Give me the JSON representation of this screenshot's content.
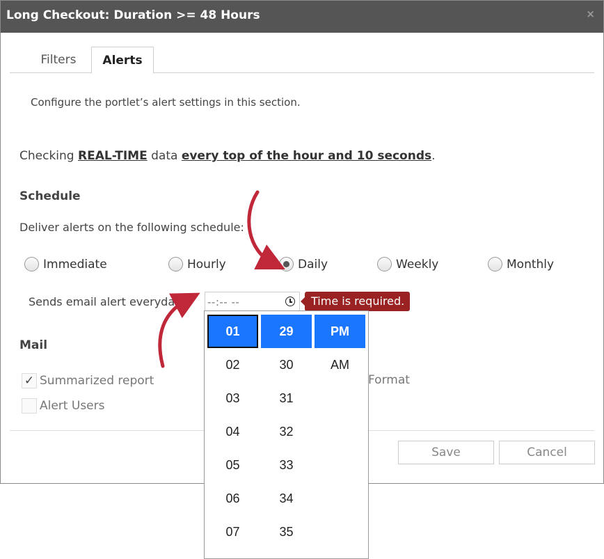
{
  "dialog": {
    "title": "Long Checkout: Duration >= 48 Hours",
    "close_glyph": "×"
  },
  "tabs": [
    {
      "label": "Filters"
    },
    {
      "label": "Alerts"
    }
  ],
  "alerts": {
    "description": "Configure the portlet’s alert settings in this section.",
    "checking_prefix": "Checking ",
    "checking_source": "REAL-TIME",
    "checking_mid": " data ",
    "checking_frequency": "every top of the hour and 10 seconds",
    "checking_suffix": ".",
    "schedule_heading": "Schedule",
    "deliver_text": "Deliver alerts on the following schedule:",
    "schedule_options": [
      {
        "label": "Immediate",
        "checked": false
      },
      {
        "label": "Hourly",
        "checked": false
      },
      {
        "label": "Daily",
        "checked": true
      },
      {
        "label": "Weekly",
        "checked": false
      },
      {
        "label": "Monthly",
        "checked": false
      }
    ],
    "sends_label": "Sends email alert everyday",
    "time_value": "--:-- --",
    "time_error": "Time is required.",
    "mail_heading": "Mail",
    "summarized_label": "Summarized report",
    "summarized_checked": true,
    "format_label_partial": "Format",
    "alert_users_label": "Alert Users",
    "alert_users_checked": false,
    "checkmark_glyph": "✓"
  },
  "buttons": {
    "save": "Save",
    "cancel": "Cancel"
  },
  "time_picker": {
    "hours": [
      "01",
      "02",
      "03",
      "04",
      "05",
      "06",
      "07"
    ],
    "minutes": [
      "29",
      "30",
      "31",
      "32",
      "33",
      "34",
      "35"
    ],
    "periods": [
      "PM",
      "AM"
    ],
    "selected_hour": "01",
    "selected_minute": "29",
    "selected_period": "PM"
  },
  "colors": {
    "titlebar": "#555555",
    "picker_selected": "#1a75ff",
    "error_tooltip": "#9a2222",
    "annotation_arrow": "#c0283a"
  },
  "icons": {
    "time_input": "clock-icon"
  }
}
